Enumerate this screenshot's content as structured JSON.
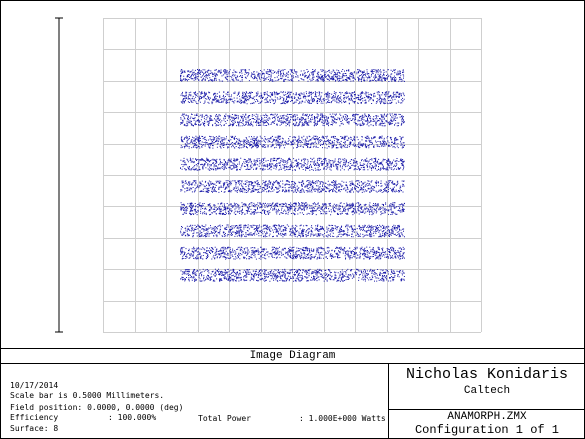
{
  "diagram": {
    "title": "Image Diagram",
    "spot_color": "#1a1aa8",
    "grid_color": "#cfcfcf",
    "scale_bar_mm": 0.5,
    "stripe_count": 10
  },
  "info": {
    "date": "10/17/2014",
    "scale_bar": "Scale bar is 0.5000 Millimeters.",
    "field_position": "Field position: 0.0000, 0.0000 (deg)",
    "efficiency_label": "Efficiency",
    "efficiency_value": ": 100.000%",
    "total_power_label": "Total Power",
    "total_power_value": ": 1.000E+000 Watts",
    "surface": "Surface: 8"
  },
  "titleblock": {
    "author": "Nicholas Konidaris",
    "organization": "Caltech",
    "file": "ANAMORPH.ZMX",
    "configuration": "Configuration 1 of 1"
  }
}
